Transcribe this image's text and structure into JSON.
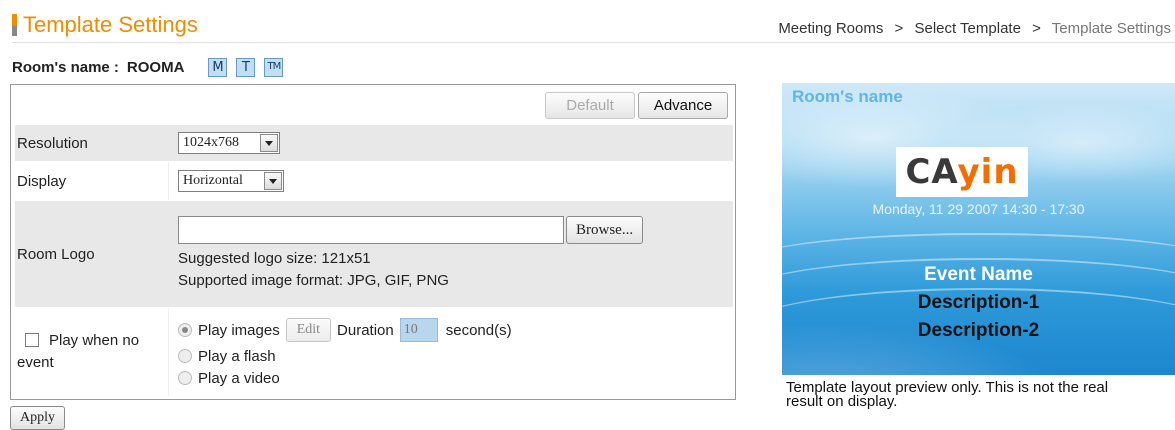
{
  "header": {
    "title": "Template Settings",
    "breadcrumb": [
      "Meeting Rooms",
      "Select Template",
      "Template Settings"
    ],
    "breadcrumb_sep": ">"
  },
  "room": {
    "label": "Room's name :",
    "name": "ROOMA",
    "mode_buttons": [
      "M",
      "T",
      "TM"
    ]
  },
  "toolbar": {
    "default_label": "Default",
    "advance_label": "Advance"
  },
  "form": {
    "resolution": {
      "label": "Resolution",
      "value": "1024x768"
    },
    "display": {
      "label": "Display",
      "value": "Horizontal"
    },
    "room_logo": {
      "label": "Room Logo",
      "file_value": "",
      "browse_label": "Browse...",
      "hint_size": "Suggested logo size: 121x51",
      "hint_format": "Supported image format: JPG, GIF, PNG"
    },
    "play_when_no_event": {
      "label_line1": "Play when no",
      "label_line2": "event",
      "checked": false,
      "options": {
        "images": "Play images",
        "edit_label": "Edit",
        "duration_label": "Duration",
        "duration_value": "10",
        "duration_unit": "second(s)",
        "flash": "Play a flash",
        "video": "Play a video"
      },
      "selected": "images"
    }
  },
  "apply_label": "Apply",
  "preview": {
    "title": "Room's name",
    "logo_main": "CA",
    "logo_accent": "yin",
    "date": "Monday, 11 29 2007 14:30 - 17:30",
    "event_name": "Event Name",
    "description_1": "Description-1",
    "description_2": "Description-2",
    "note_line1": "Template layout preview only. This is not the real",
    "note_line2": "result on display."
  },
  "colors": {
    "accent": "#f08c00",
    "preview_title": "#5fb5e4",
    "duration_field": "#b9d6ef"
  }
}
